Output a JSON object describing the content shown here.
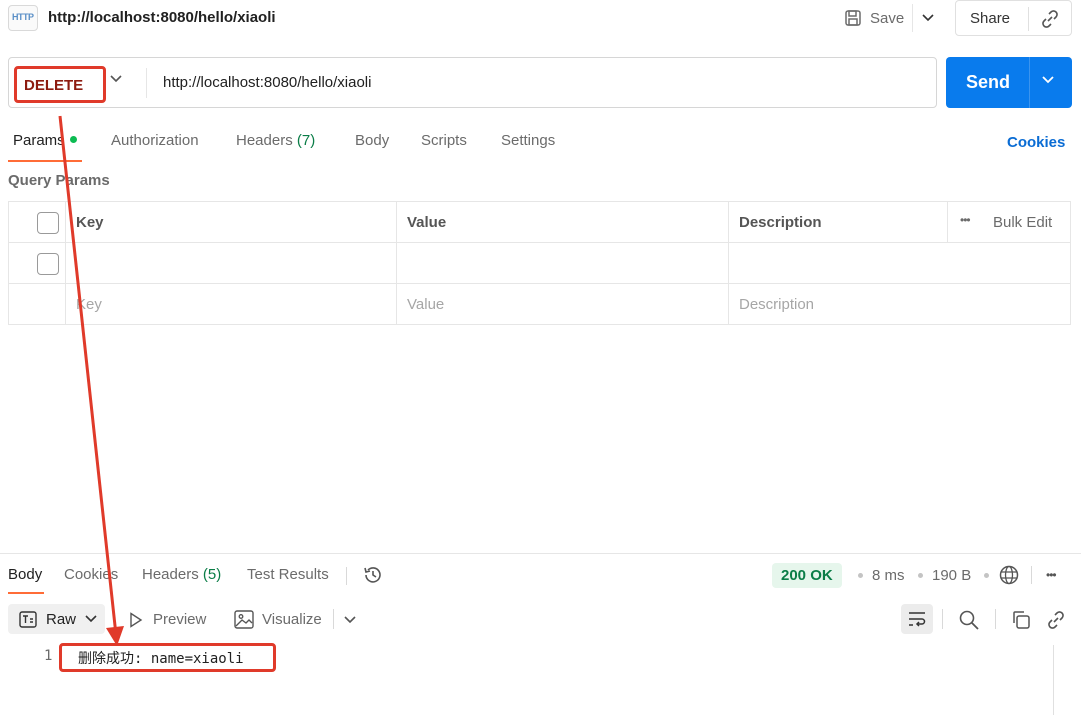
{
  "header": {
    "http_badge": "HTTP",
    "title": "http://localhost:8080/hello/xiaoli",
    "save_label": "Save",
    "share_label": "Share"
  },
  "request": {
    "method": "DELETE",
    "url": "http://localhost:8080/hello/xiaoli",
    "send_label": "Send"
  },
  "tabs": {
    "params": "Params",
    "authorization": "Authorization",
    "headers": "Headers",
    "headers_count": "(7)",
    "body": "Body",
    "scripts": "Scripts",
    "settings": "Settings",
    "cookies": "Cookies"
  },
  "query_params": {
    "title": "Query Params",
    "columns": {
      "key": "Key",
      "value": "Value",
      "description": "Description"
    },
    "bulk_edit": "Bulk Edit",
    "placeholders": {
      "key": "Key",
      "value": "Value",
      "description": "Description"
    }
  },
  "response": {
    "tabs": {
      "body": "Body",
      "cookies": "Cookies",
      "headers": "Headers",
      "headers_count": "(5)",
      "test_results": "Test Results"
    },
    "status": "200 OK",
    "time": "8 ms",
    "size": "190 B",
    "format": "Raw",
    "preview": "Preview",
    "visualize": "Visualize",
    "line_number": "1",
    "body_text": "删除成功: name=xiaoli"
  },
  "colors": {
    "accent": "#ff6c37",
    "send": "#097bed",
    "annotation": "#e03a2a",
    "method": "#8d1b10",
    "status_ok": "#0a7d47"
  }
}
